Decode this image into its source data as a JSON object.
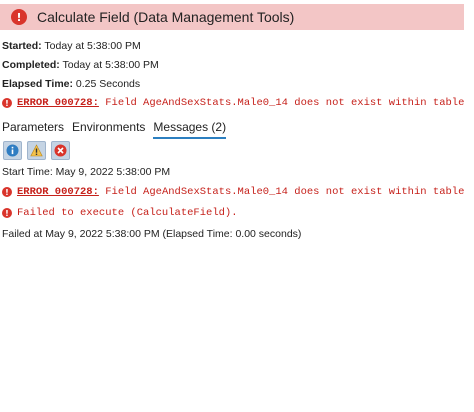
{
  "header": {
    "title": "Calculate Field (Data Management Tools)",
    "status_icon": "error-icon"
  },
  "meta": {
    "started_label": "Started:",
    "started_value": "Today at 5:38:00 PM",
    "completed_label": "Completed:",
    "completed_value": "Today at 5:38:00 PM",
    "elapsed_label": "Elapsed Time:",
    "elapsed_value": "0.25 Seconds"
  },
  "summary_error": {
    "code": "ERROR 000728:",
    "text": "Field AgeAndSexStats.Male0_14 does not exist within table"
  },
  "tabs": [
    {
      "label": "Parameters"
    },
    {
      "label": "Environments"
    },
    {
      "label": "Messages (2)"
    }
  ],
  "toolbar": {
    "info_icon": "info-icon",
    "warning_icon": "warning-icon",
    "error_icon": "error-icon"
  },
  "messages": {
    "start_time": "Start Time: May 9, 2022 5:38:00 PM",
    "error1_code": "ERROR 000728:",
    "error1_text": "Field AgeAndSexStats.Male0_14 does not exist within table",
    "error2_text": "Failed to execute (CalculateField).",
    "failed": "Failed at May 9, 2022 5:38:00 PM (Elapsed Time: 0.00 seconds)"
  },
  "colors": {
    "header_bg": "#f3c6c6",
    "error_red": "#c6211b",
    "accent": "#2c7fc0"
  }
}
